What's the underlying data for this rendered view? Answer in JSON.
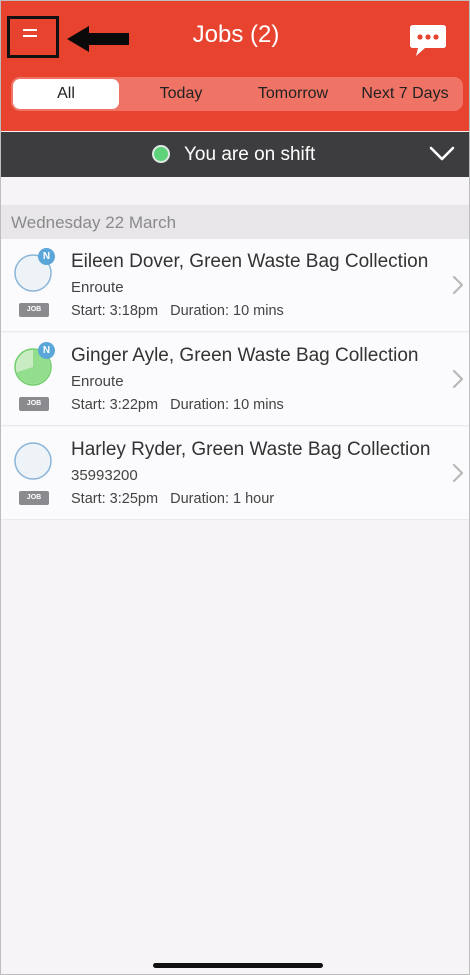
{
  "header": {
    "title": "Jobs (2)",
    "accent_color": "#e8432f",
    "menu_icon": "hamburger-menu-icon",
    "chat_icon": "chat-bubble-icon"
  },
  "filters": {
    "tabs": [
      {
        "label": "All",
        "active": true
      },
      {
        "label": "Today",
        "active": false
      },
      {
        "label": "Tomorrow",
        "active": false
      },
      {
        "label": "Next 7 Days",
        "active": false
      }
    ]
  },
  "shift": {
    "status_text": "You are on shift",
    "status_color": "#5fd37a"
  },
  "date_group": {
    "label": "Wednesday 22 March"
  },
  "jobs": [
    {
      "title": "Eileen Dover, Green Waste Bag Collection",
      "status": "Enroute",
      "start": "Start: 3:18pm",
      "duration": "Duration: 10 mins",
      "tag": "JOB",
      "badge": "N",
      "progress": 0
    },
    {
      "title": "Ginger Ayle, Green Waste Bag Collection",
      "status": "Enroute",
      "start": "Start: 3:22pm",
      "duration": "Duration: 10 mins",
      "tag": "JOB",
      "badge": "N",
      "progress": 0.7
    },
    {
      "title": "Harley Ryder, Green Waste Bag Collection",
      "status": "35993200",
      "start": "Start: 3:25pm",
      "duration": "Duration: 1 hour",
      "tag": "JOB",
      "badge": "",
      "progress": 0
    }
  ]
}
